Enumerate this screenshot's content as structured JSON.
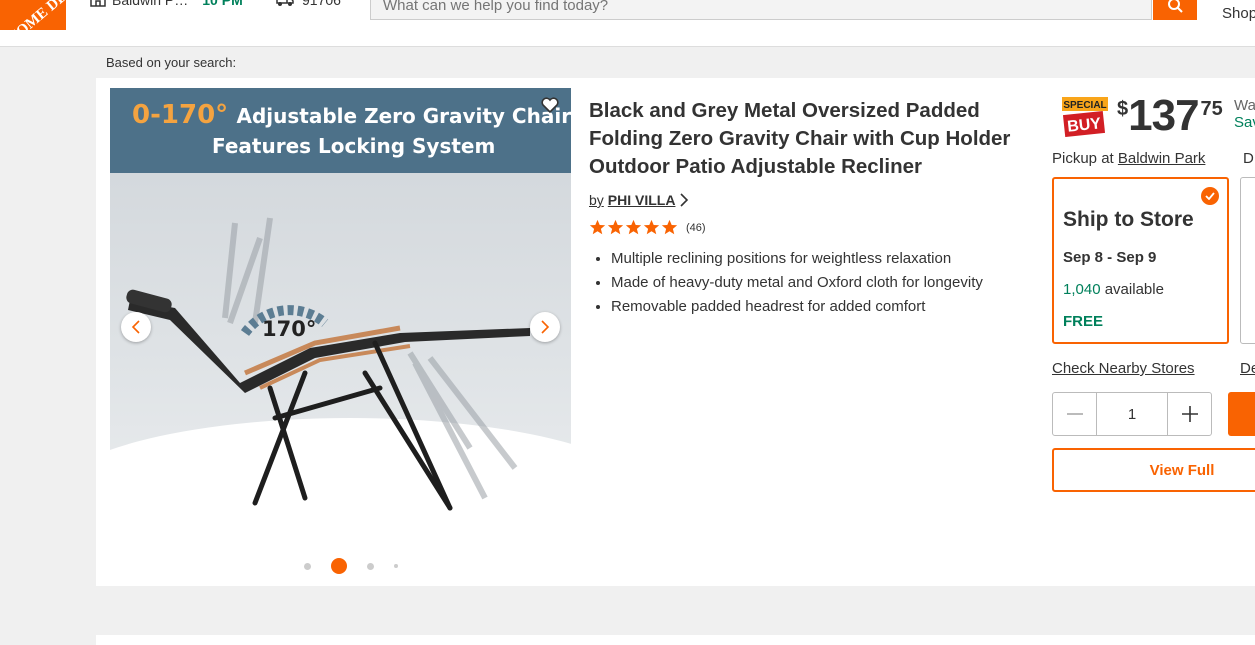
{
  "header": {
    "logo_text": "HOME DEPOT",
    "store_name": "Baldwin P…",
    "store_hours": "10 PM",
    "zip": "91706",
    "search_placeholder": "What can we help you find today?",
    "shop_label": "Shop"
  },
  "based_on": "Based on your search:",
  "product": {
    "image": {
      "banner_accent": "0-170°",
      "banner_line1": "Adjustable Zero Gravity Chair",
      "banner_line2": "Features Locking System",
      "angle_label": "170°",
      "current_slide": 2,
      "slide_count": 4
    },
    "title": "Black and Grey Metal Oversized Padded Folding Zero Gravity Chair with Cup Holder Outdoor Patio Adjustable Recliner",
    "by_label": "by",
    "brand": "PHI VILLA",
    "rating": 5,
    "review_count": "(46)",
    "bullets": [
      "Multiple reclining positions for weightless relaxation",
      "Made of heavy-duty metal and Oxford cloth for longevity",
      "Removable padded headrest for added comfort"
    ]
  },
  "buybox": {
    "badge_top": "SPECIAL",
    "badge_bottom": "BUY",
    "price_dollar_sign": "$",
    "price_main": "137",
    "price_cents": "75",
    "was_label": "Wa",
    "save_label": "Sav",
    "pickup_label": "Pickup at",
    "pickup_store": "Baldwin Park",
    "delivery_label": "D",
    "ship": {
      "title": "Ship to Store",
      "dates": "Sep 8 - Sep 9",
      "available_count": "1,040",
      "available_label": "available",
      "price": "FREE"
    },
    "check_nearby": "Check Nearby Stores",
    "delivery_link": "De",
    "quantity": "1",
    "view_full": "View Full"
  },
  "colors": {
    "brand_orange": "#f96302",
    "green": "#00805b"
  }
}
